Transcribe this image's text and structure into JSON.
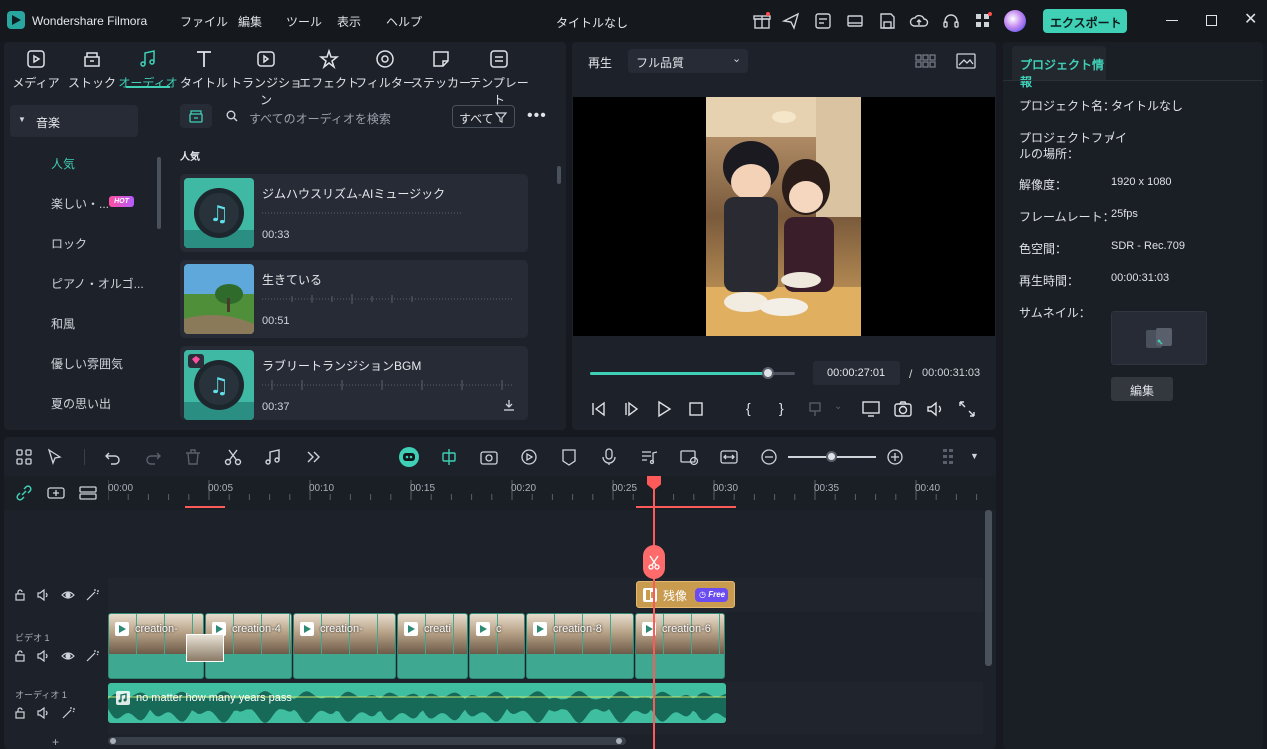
{
  "app": {
    "name": "Wondershare Filmora",
    "doc_title": "タイトルなし",
    "export_label": "エクスポート"
  },
  "menu": [
    "ファイル",
    "編集",
    "ツール",
    "表示",
    "ヘルプ"
  ],
  "toolbar": [
    {
      "label": "メディア",
      "icon": "media-icon"
    },
    {
      "label": "ストック",
      "icon": "stock-icon"
    },
    {
      "label": "オーディオ",
      "icon": "music-note-icon",
      "active": true
    },
    {
      "label": "タイトル",
      "icon": "title-t-icon"
    },
    {
      "label": "トランジション",
      "icon": "transition-icon"
    },
    {
      "label": "エフェクト",
      "icon": "effect-icon"
    },
    {
      "label": "フィルター",
      "icon": "filter-icon"
    },
    {
      "label": "ステッカー",
      "icon": "sticker-icon"
    },
    {
      "label": "テンプレート",
      "icon": "template-icon"
    }
  ],
  "categories": {
    "parent": "音楽",
    "items": [
      "人気",
      "楽しい・...",
      "ロック",
      "ピアノ・オルゴ...",
      "和風",
      "優しい雰囲気",
      "夏の思い出"
    ],
    "hot_badge": "HOT"
  },
  "search": {
    "placeholder": "すべてのオーディオを検索",
    "filter_label": "すべて"
  },
  "section_title": "人気",
  "audio_list": [
    {
      "title": "ジムハウスリズム-AIミュージック",
      "duration": "00:33"
    },
    {
      "title": "生きている",
      "duration": "00:51"
    },
    {
      "title": "ラブリートランジションBGM",
      "duration": "00:37"
    }
  ],
  "player": {
    "tab": "再生",
    "quality": "フル品質",
    "current_time": "00:00:27:01",
    "total_time": "00:00:31:03",
    "separator": "/",
    "progress": 0.87
  },
  "project": {
    "tab": "プロジェクト情報",
    "rows": [
      {
        "label": "プロジェクト名：",
        "value": "タイトルなし"
      },
      {
        "label": "プロジェクトファイ",
        "label2": "ルの場所：",
        "value": "/"
      },
      {
        "label": "解像度：",
        "value": "1920 x 1080"
      },
      {
        "label": "フレームレート：",
        "value": "25fps"
      },
      {
        "label": "色空間：",
        "value": "SDR - Rec.709"
      },
      {
        "label": "再生時間：",
        "value": "00:00:31:03"
      },
      {
        "label": "サムネイル：",
        "value": ""
      }
    ],
    "edit_button": "編集"
  },
  "timeline": {
    "ruler": [
      "00:00",
      "00:05",
      "00:10",
      "00:15",
      "00:20",
      "00:25",
      "00:30",
      "00:35",
      "00:40"
    ],
    "effect_clip": {
      "label": "残像",
      "badge": "Free"
    },
    "tracks": {
      "video": "ビデオ 1",
      "audio": "オーディオ 1"
    },
    "video_clips": [
      "creation-",
      "creation-4",
      "creation-",
      "creati",
      "c",
      "creation-8",
      "creation-6"
    ],
    "audio_clip": "no matter how many years pass"
  },
  "colors": {
    "accent": "#3fd0b6",
    "playhead": "#ff5a5a",
    "export": "#3fd0b6",
    "effect": "#c99b4f"
  }
}
